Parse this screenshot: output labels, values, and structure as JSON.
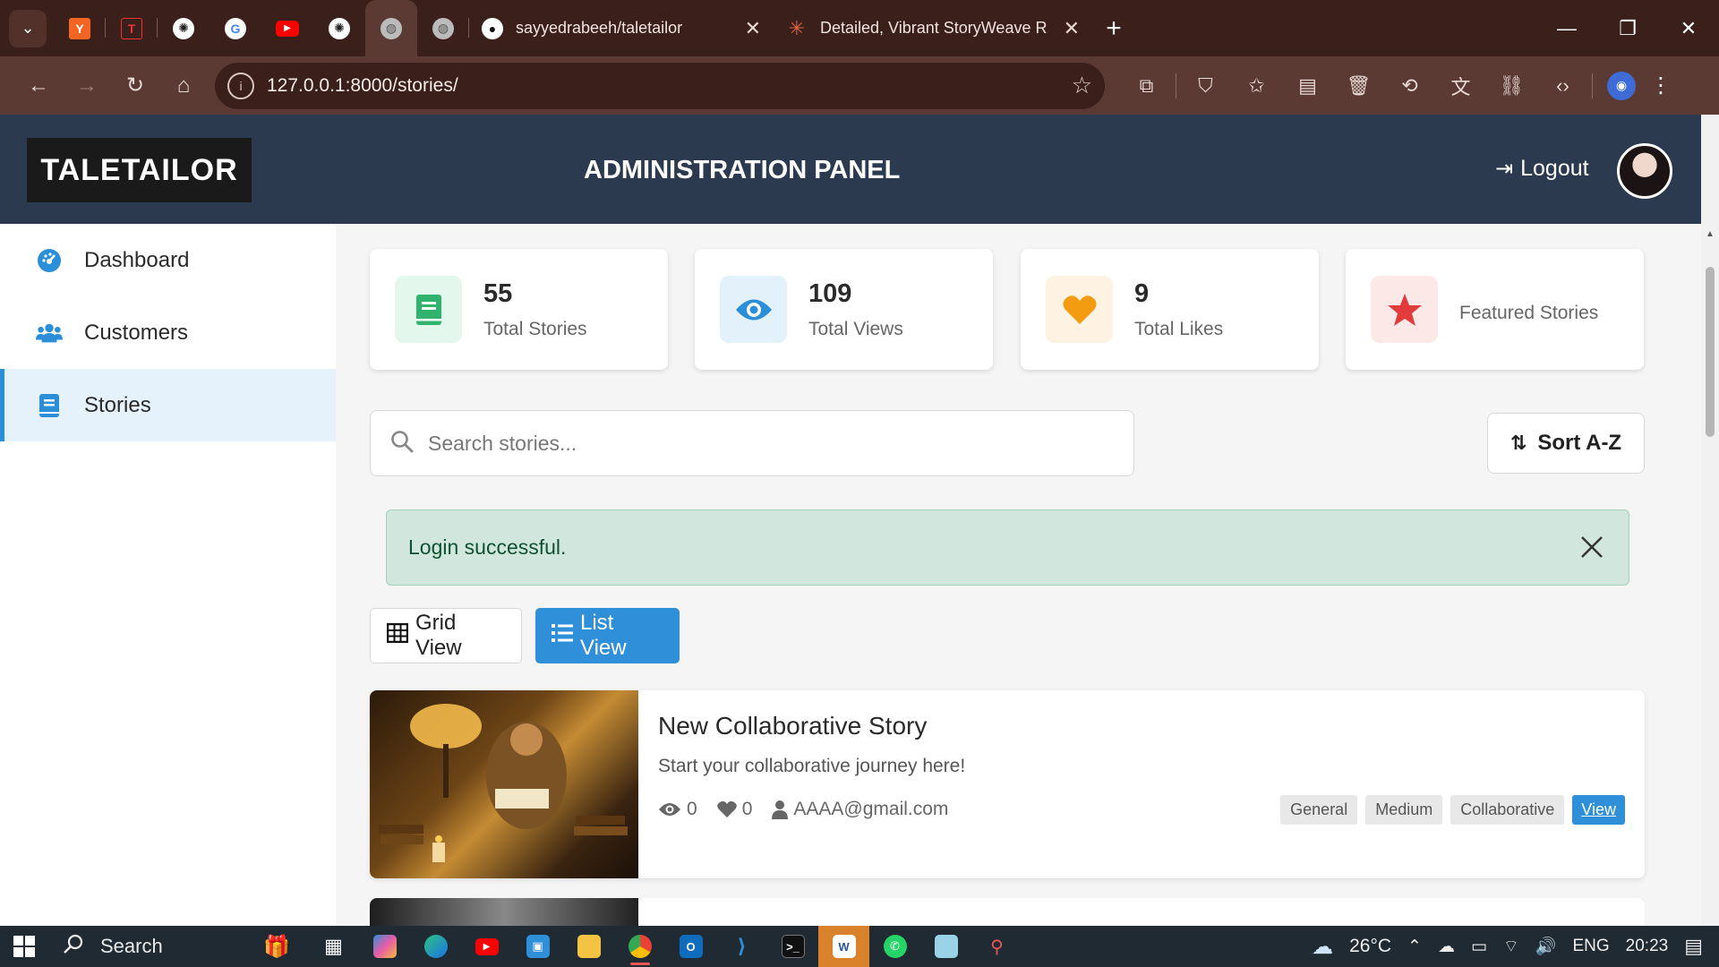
{
  "browser": {
    "tabs": [
      {
        "title": "sayyedrabeeh/taletailor"
      },
      {
        "title": "Detailed, Vibrant StoryWeave R"
      }
    ],
    "url": "127.0.0.1:8000/stories/"
  },
  "header": {
    "brand": "TALETAILOR",
    "title": "ADMINISTRATION PANEL",
    "logout": "Logout"
  },
  "sidebar": {
    "items": [
      {
        "label": "Dashboard",
        "icon": "dashboard-icon"
      },
      {
        "label": "Customers",
        "icon": "users-icon"
      },
      {
        "label": "Stories",
        "icon": "book-icon",
        "active": true
      }
    ]
  },
  "stats": [
    {
      "value": "55",
      "label": "Total Stories",
      "icon": "book-icon",
      "color": "#2fb36d"
    },
    {
      "value": "109",
      "label": "Total Views",
      "icon": "eye-icon",
      "color": "#2a8fd8"
    },
    {
      "value": "9",
      "label": "Total Likes",
      "icon": "heart-icon",
      "color": "#f39c12"
    },
    {
      "value": "",
      "label": "Featured Stories",
      "icon": "star-icon",
      "color": "#e23b3b"
    }
  ],
  "search": {
    "placeholder": "Search stories..."
  },
  "sort": {
    "label": "Sort A-Z"
  },
  "alert": {
    "message": "Login successful."
  },
  "views": {
    "grid": "Grid View",
    "list": "List View"
  },
  "stories": [
    {
      "title": "New Collaborative Story",
      "description": "Start your collaborative journey here!",
      "views": "0",
      "likes": "0",
      "author": "AAAA@gmail.com",
      "tags": [
        "General",
        "Medium",
        "Collaborative"
      ],
      "action": "View"
    }
  ],
  "taskbar": {
    "search": "Search",
    "weather": "26°C",
    "language": "ENG",
    "time": "20:23"
  },
  "colors": {
    "header": "#2b3a4e",
    "accent": "#2f8fd9",
    "alert_bg": "#d1e7dd"
  }
}
